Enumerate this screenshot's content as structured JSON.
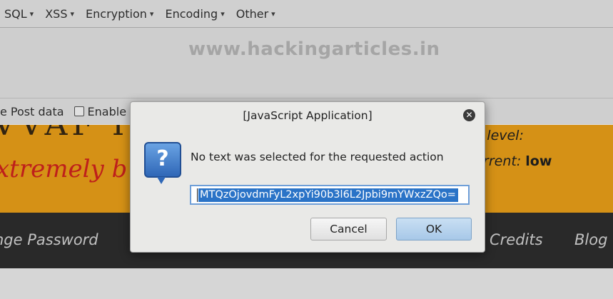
{
  "toolbar": {
    "menus": [
      {
        "label": "SQL",
        "caret": "▾"
      },
      {
        "label": "XSS",
        "caret": "▾"
      },
      {
        "label": "Encryption",
        "caret": "▾"
      },
      {
        "label": "Encoding",
        "caret": "▾"
      },
      {
        "label": "Other",
        "caret": "▾"
      }
    ]
  },
  "watermark": "www.hackingarticles.in",
  "options": {
    "post_data_label": "e Post data",
    "enable_referrer_label": "Enable Re"
  },
  "banner": {
    "dark_fragment": "VVAF I",
    "left_text": "xtremely b",
    "security_level_label": "y level:",
    "current_label": "urrent: ",
    "current_value": "low",
    "accent_color": "#f3a51a",
    "red_text_color": "#d9241f"
  },
  "nav": {
    "left_item": "nge Password",
    "credits": "Credits",
    "blog": "Blog"
  },
  "dialog": {
    "title": "[JavaScript Application]",
    "icon": "question-icon",
    "message": "No text was selected for the requested action",
    "input_value": "MTQzOjovdmFyL2xpYi90b3l6L2Jpbi9mYWxzZQo=",
    "cancel_label": "Cancel",
    "ok_label": "OK",
    "close_glyph": "✕"
  }
}
